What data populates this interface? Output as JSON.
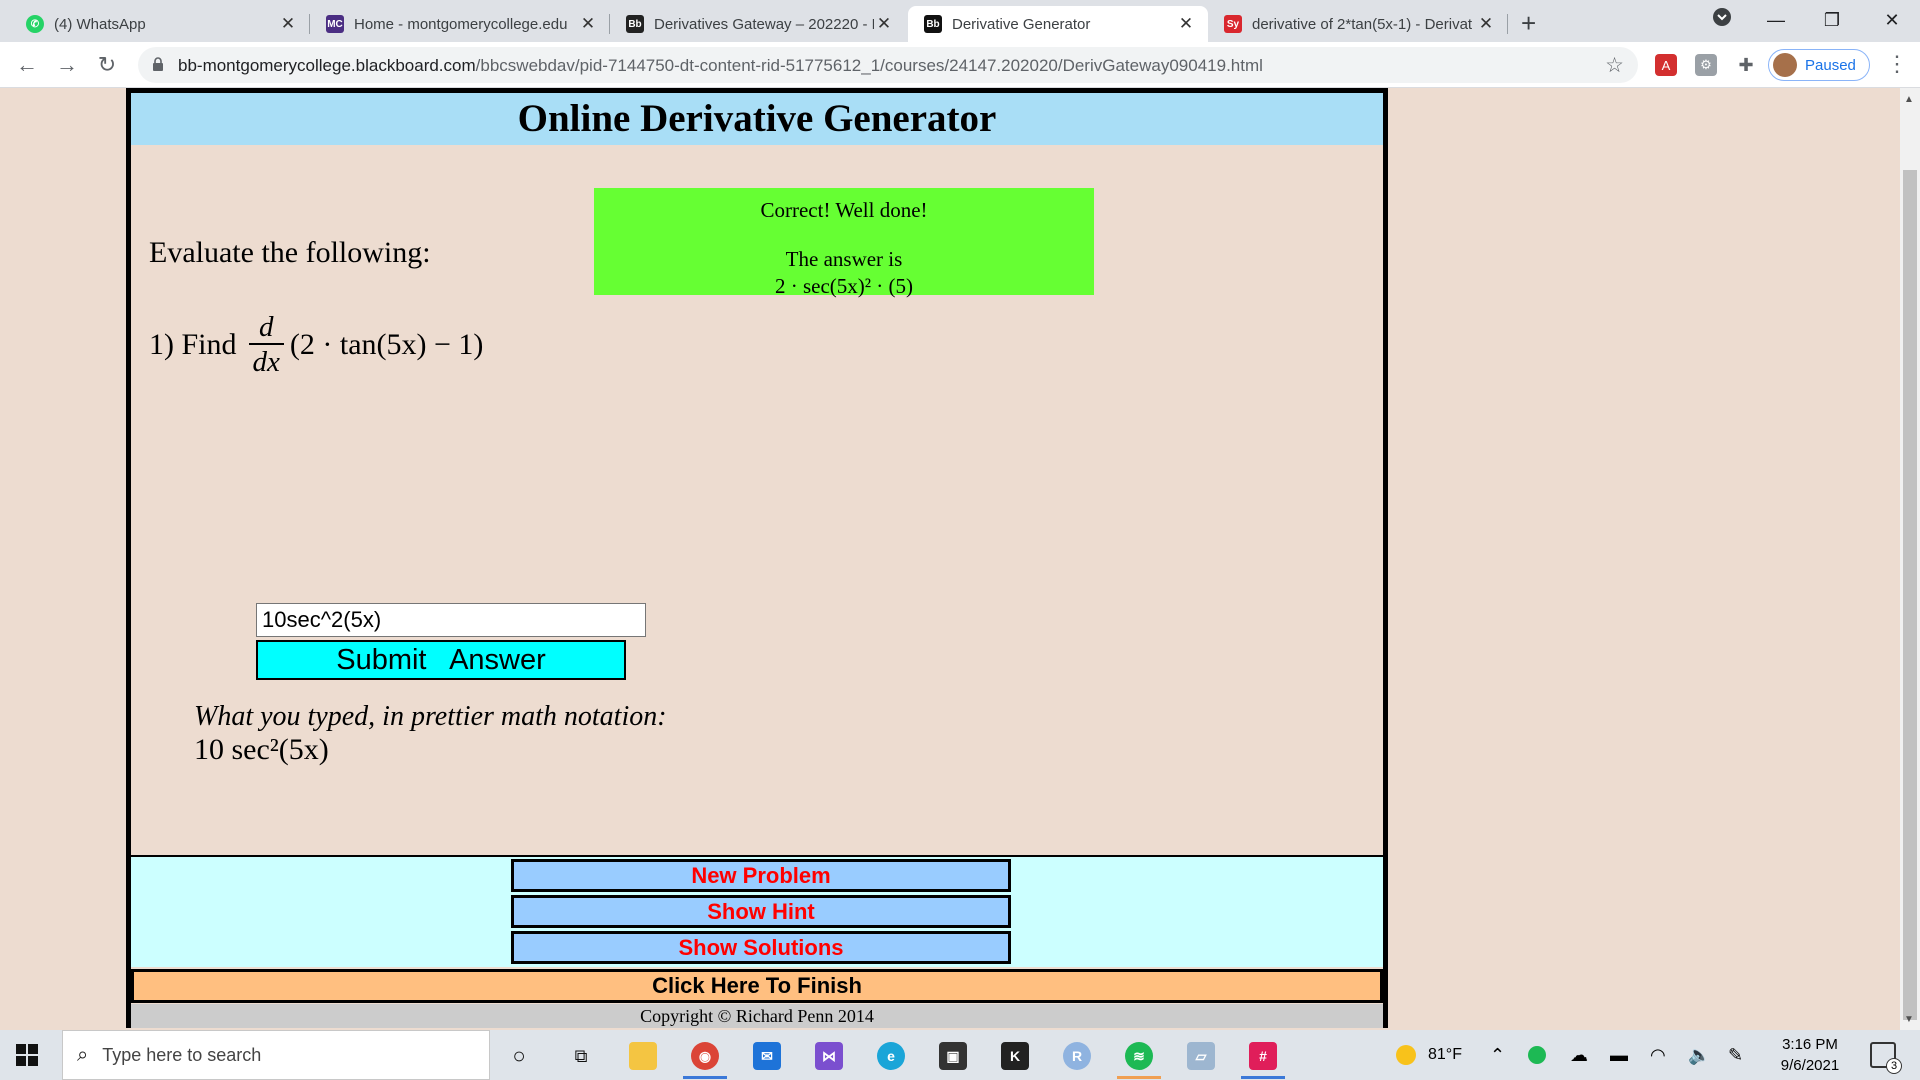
{
  "browser": {
    "tabs": [
      {
        "title": "(4) WhatsApp",
        "icon": "whatsapp-icon",
        "color": "#25d366",
        "active": false
      },
      {
        "title": "Home - montgomerycollege.edu",
        "icon": "mc-icon",
        "color": "#4b2e83",
        "active": false
      },
      {
        "title": "Derivatives Gateway – 202220 - M",
        "icon": "blackboard-icon",
        "color": "#222222",
        "active": false
      },
      {
        "title": "Derivative Generator",
        "icon": "blackboard-icon",
        "color": "#111111",
        "active": true
      },
      {
        "title": "derivative of 2*tan(5x-1) - Derivat",
        "icon": "symbolab-icon",
        "color": "#d9272e",
        "active": false
      }
    ],
    "url_host": "bb-montgomerycollege.blackboard.com",
    "url_path": "/bbcswebdav/pid-7144750-dt-content-rid-51775612_1/courses/24147.202020/DerivGateway090419.html",
    "profile_label": "Paused"
  },
  "page": {
    "title": "Online Derivative Generator",
    "feedback": {
      "line1": "Correct! Well done!",
      "line2": "The answer is",
      "answer_math": "2 · sec(5x)² · (5)",
      "bg": "#66ff33"
    },
    "prompt": "Evaluate the following:",
    "question": {
      "prefix": "1) Find",
      "numerator": "d",
      "denominator": "dx",
      "expression": "(2 · tan(5x) − 1)"
    },
    "answer_input_value": "10sec^2(5x)",
    "submit_label": "Submit   Answer",
    "pretty_label": "What you typed, in prettier math notation:",
    "pretty_math": "10 sec²(5x)",
    "buttons": {
      "new_problem": "New Problem",
      "show_hint": "Show Hint",
      "show_solutions": "Show Solutions",
      "finish": "Click Here To Finish"
    },
    "copyright": "Copyright © Richard Penn 2014"
  },
  "taskbar": {
    "search_placeholder": "Type here to search",
    "weather": "81°F",
    "time": "3:16 PM",
    "date": "9/6/2021",
    "notification_count": "3"
  }
}
